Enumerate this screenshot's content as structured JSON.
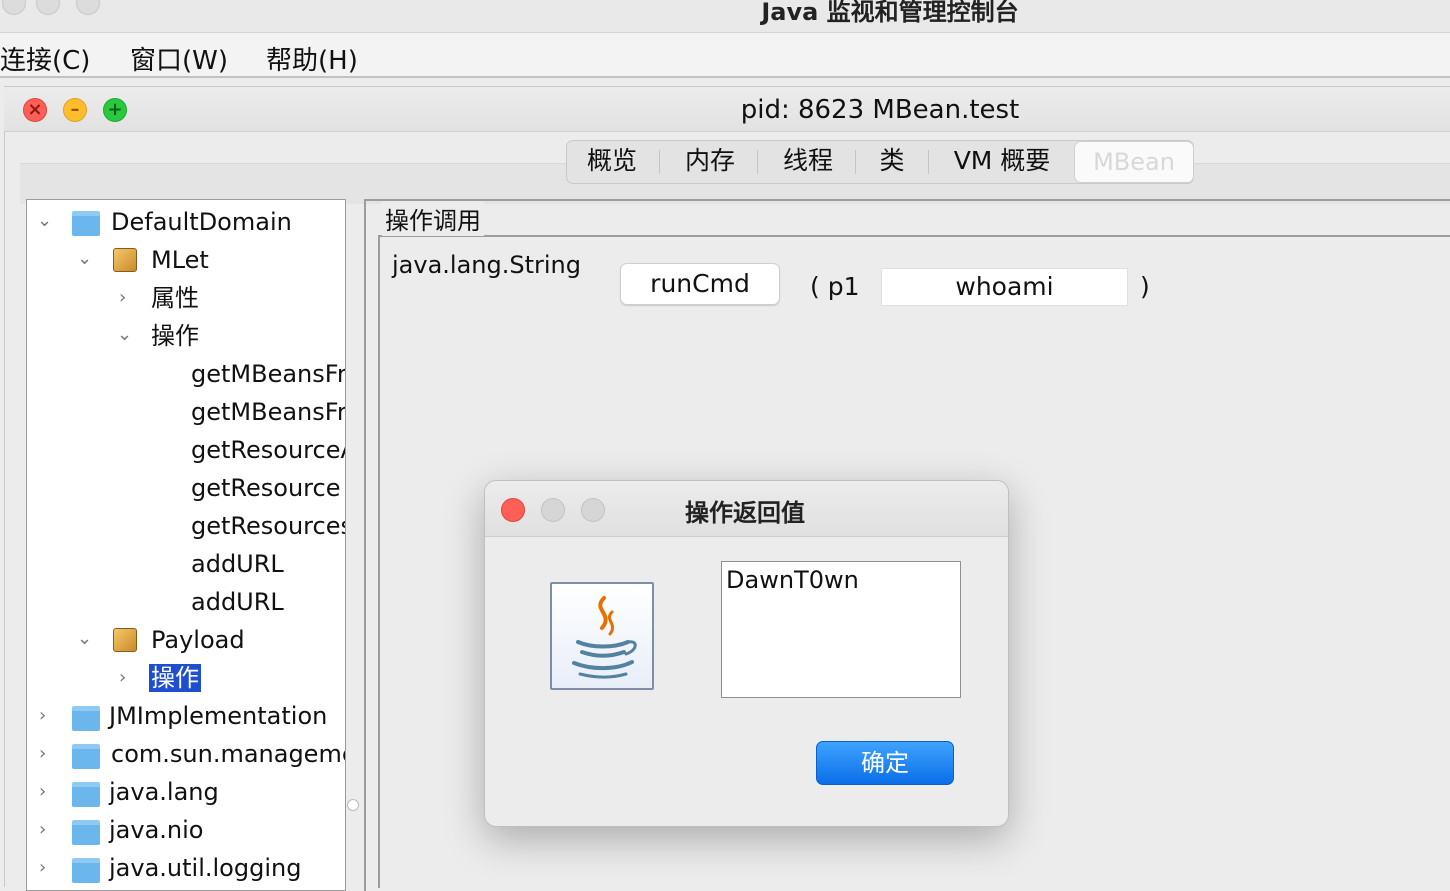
{
  "app": {
    "title": "Java 监视和管理控制台"
  },
  "menubar": {
    "items": [
      "连接(C)",
      "窗口(W)",
      "帮助(H)"
    ]
  },
  "window": {
    "title": "pid: 8623 MBean.test"
  },
  "tabs": {
    "items": [
      "概览",
      "内存",
      "线程",
      "类",
      "VM 概要"
    ],
    "active": "MBean"
  },
  "tree": {
    "domain": "DefaultDomain",
    "mlet": "MLet",
    "attributes": "属性",
    "operations": "操作",
    "ops": [
      "getMBeansFro",
      "getMBeansFro",
      "getResourceA",
      "getResource",
      "getResources",
      "addURL",
      "addURL"
    ],
    "payload": "Payload",
    "payload_ops": "操作",
    "other_domains": [
      "JMImplementation",
      "com.sun.manageme",
      "java.lang",
      "java.nio",
      "java.util.logging"
    ]
  },
  "operation_panel": {
    "group_title": "操作调用",
    "return_type": "java.lang.String",
    "method_button": "runCmd",
    "param_label": "( p1",
    "param_value": "whoami",
    "close_paren": ")"
  },
  "dialog": {
    "title": "操作返回值",
    "result": "DawnT0wn",
    "ok_label": "确定"
  },
  "colors": {
    "accent": "#0a6ee8",
    "selection": "#1e4fd0",
    "folder": "#6cb6ee"
  }
}
